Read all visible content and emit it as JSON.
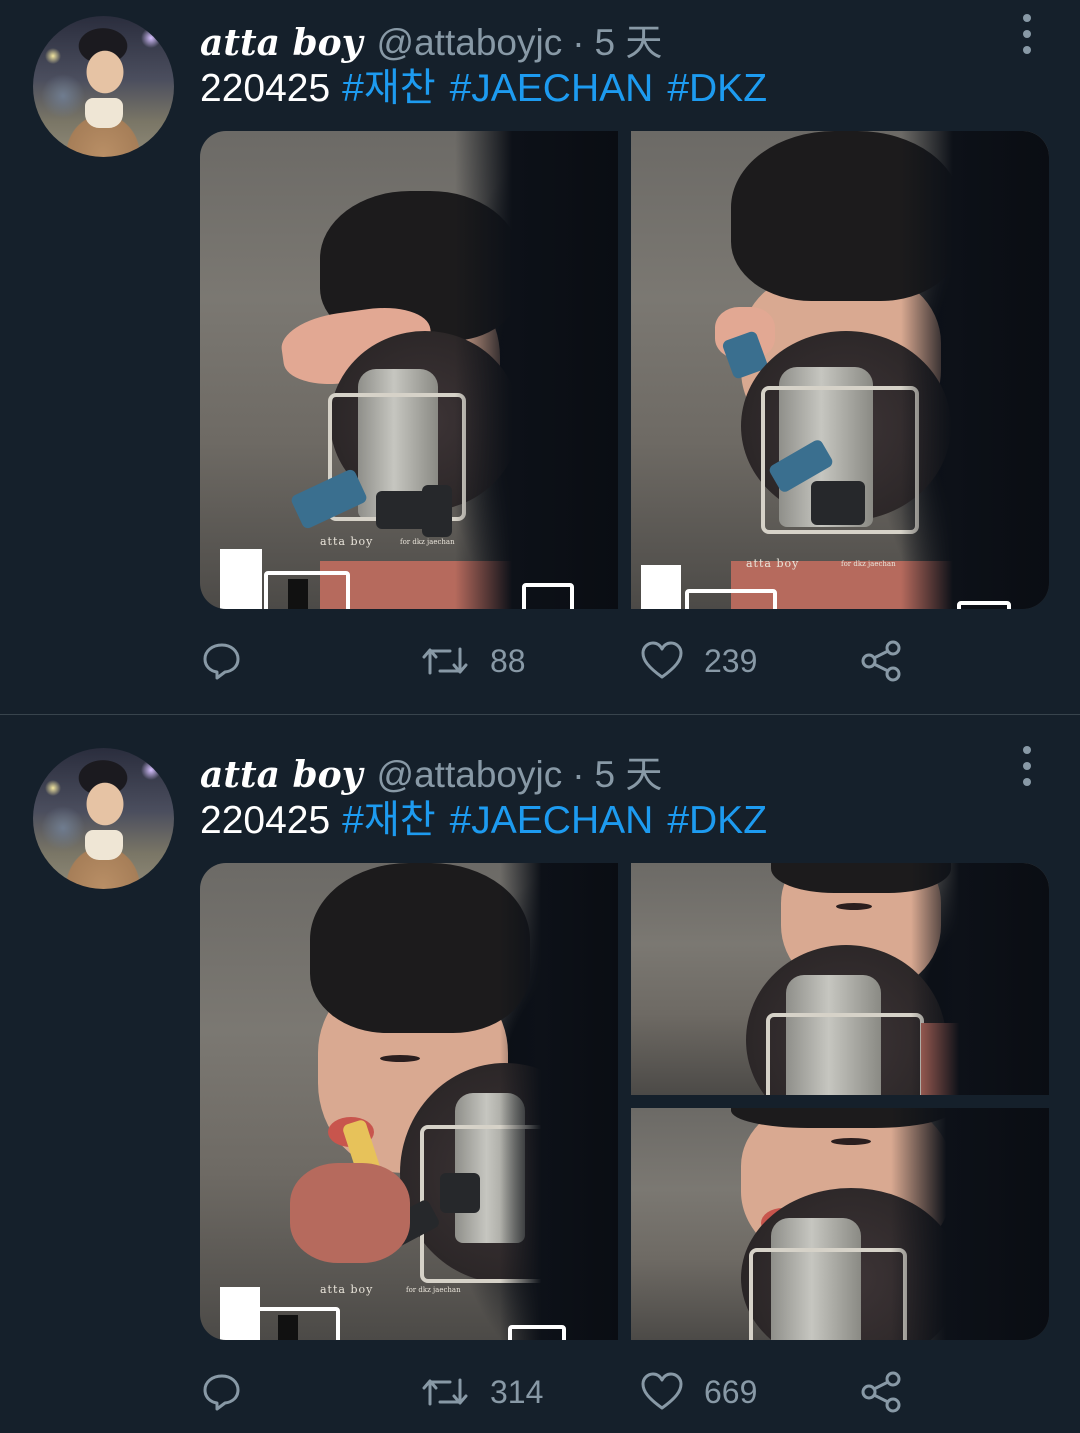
{
  "tweets": [
    {
      "author": {
        "display_name": "atta boy",
        "handle": "@attaboyjc",
        "time": "5 天"
      },
      "text": {
        "date": "220425",
        "hashtags": [
          "#재찬",
          "#JAECHAN",
          "#DKZ"
        ]
      },
      "media": {
        "photos": [
          {
            "watermark": "atta boy",
            "watermark_sub": "for dkz jaechan"
          },
          {
            "watermark": "atta boy",
            "watermark_sub": "for dkz jaechan"
          }
        ]
      },
      "stats": {
        "replies": "",
        "retweets": "88",
        "likes": "239"
      }
    },
    {
      "author": {
        "display_name": "atta boy",
        "handle": "@attaboyjc",
        "time": "5 天"
      },
      "text": {
        "date": "220425",
        "hashtags": [
          "#재찬",
          "#JAECHAN",
          "#DKZ"
        ]
      },
      "media": {
        "photos": [
          {
            "watermark": "atta boy",
            "watermark_sub": "for dkz jaechan"
          },
          {
            "watermark": "",
            "watermark_sub": ""
          },
          {
            "watermark": "",
            "watermark_sub": ""
          }
        ]
      },
      "stats": {
        "replies": "",
        "retweets": "314",
        "likes": "669"
      }
    }
  ],
  "icons": {
    "reply": "reply-icon",
    "retweet": "retweet-icon",
    "like": "heart-icon",
    "share": "share-icon",
    "more": "more-options-icon"
  },
  "colors": {
    "background": "#15202b",
    "link": "#1d9bf0",
    "muted": "#8899a6",
    "divider": "#38444d"
  }
}
